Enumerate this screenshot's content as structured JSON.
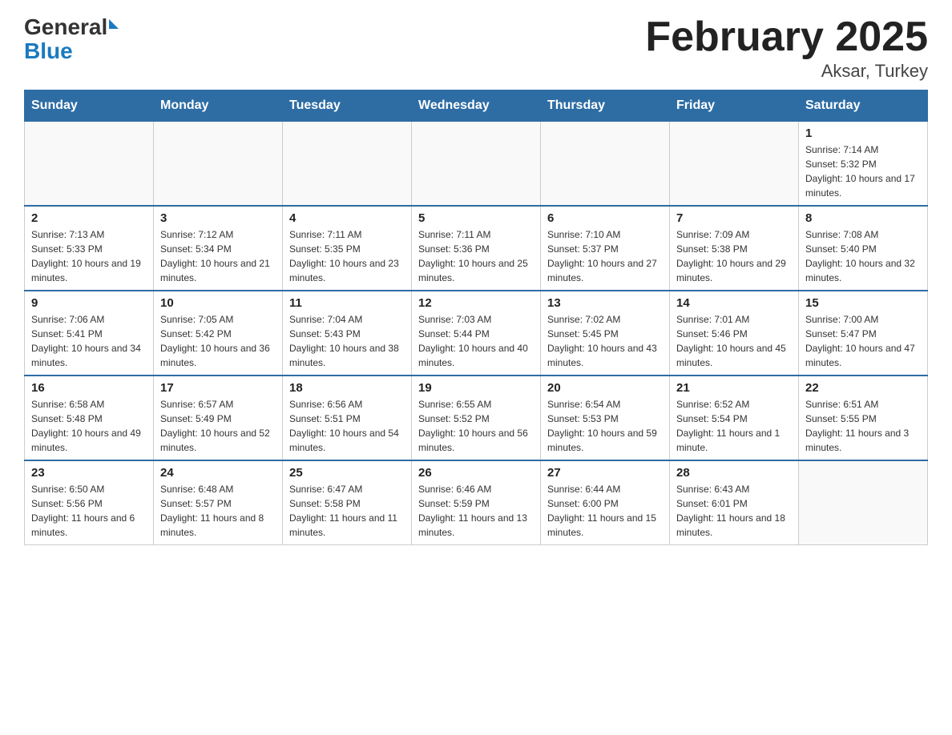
{
  "header": {
    "logo_general": "General",
    "logo_blue": "Blue",
    "month_title": "February 2025",
    "location": "Aksar, Turkey"
  },
  "weekdays": [
    "Sunday",
    "Monday",
    "Tuesday",
    "Wednesday",
    "Thursday",
    "Friday",
    "Saturday"
  ],
  "weeks": [
    [
      {
        "day": "",
        "info": ""
      },
      {
        "day": "",
        "info": ""
      },
      {
        "day": "",
        "info": ""
      },
      {
        "day": "",
        "info": ""
      },
      {
        "day": "",
        "info": ""
      },
      {
        "day": "",
        "info": ""
      },
      {
        "day": "1",
        "info": "Sunrise: 7:14 AM\nSunset: 5:32 PM\nDaylight: 10 hours and 17 minutes."
      }
    ],
    [
      {
        "day": "2",
        "info": "Sunrise: 7:13 AM\nSunset: 5:33 PM\nDaylight: 10 hours and 19 minutes."
      },
      {
        "day": "3",
        "info": "Sunrise: 7:12 AM\nSunset: 5:34 PM\nDaylight: 10 hours and 21 minutes."
      },
      {
        "day": "4",
        "info": "Sunrise: 7:11 AM\nSunset: 5:35 PM\nDaylight: 10 hours and 23 minutes."
      },
      {
        "day": "5",
        "info": "Sunrise: 7:11 AM\nSunset: 5:36 PM\nDaylight: 10 hours and 25 minutes."
      },
      {
        "day": "6",
        "info": "Sunrise: 7:10 AM\nSunset: 5:37 PM\nDaylight: 10 hours and 27 minutes."
      },
      {
        "day": "7",
        "info": "Sunrise: 7:09 AM\nSunset: 5:38 PM\nDaylight: 10 hours and 29 minutes."
      },
      {
        "day": "8",
        "info": "Sunrise: 7:08 AM\nSunset: 5:40 PM\nDaylight: 10 hours and 32 minutes."
      }
    ],
    [
      {
        "day": "9",
        "info": "Sunrise: 7:06 AM\nSunset: 5:41 PM\nDaylight: 10 hours and 34 minutes."
      },
      {
        "day": "10",
        "info": "Sunrise: 7:05 AM\nSunset: 5:42 PM\nDaylight: 10 hours and 36 minutes."
      },
      {
        "day": "11",
        "info": "Sunrise: 7:04 AM\nSunset: 5:43 PM\nDaylight: 10 hours and 38 minutes."
      },
      {
        "day": "12",
        "info": "Sunrise: 7:03 AM\nSunset: 5:44 PM\nDaylight: 10 hours and 40 minutes."
      },
      {
        "day": "13",
        "info": "Sunrise: 7:02 AM\nSunset: 5:45 PM\nDaylight: 10 hours and 43 minutes."
      },
      {
        "day": "14",
        "info": "Sunrise: 7:01 AM\nSunset: 5:46 PM\nDaylight: 10 hours and 45 minutes."
      },
      {
        "day": "15",
        "info": "Sunrise: 7:00 AM\nSunset: 5:47 PM\nDaylight: 10 hours and 47 minutes."
      }
    ],
    [
      {
        "day": "16",
        "info": "Sunrise: 6:58 AM\nSunset: 5:48 PM\nDaylight: 10 hours and 49 minutes."
      },
      {
        "day": "17",
        "info": "Sunrise: 6:57 AM\nSunset: 5:49 PM\nDaylight: 10 hours and 52 minutes."
      },
      {
        "day": "18",
        "info": "Sunrise: 6:56 AM\nSunset: 5:51 PM\nDaylight: 10 hours and 54 minutes."
      },
      {
        "day": "19",
        "info": "Sunrise: 6:55 AM\nSunset: 5:52 PM\nDaylight: 10 hours and 56 minutes."
      },
      {
        "day": "20",
        "info": "Sunrise: 6:54 AM\nSunset: 5:53 PM\nDaylight: 10 hours and 59 minutes."
      },
      {
        "day": "21",
        "info": "Sunrise: 6:52 AM\nSunset: 5:54 PM\nDaylight: 11 hours and 1 minute."
      },
      {
        "day": "22",
        "info": "Sunrise: 6:51 AM\nSunset: 5:55 PM\nDaylight: 11 hours and 3 minutes."
      }
    ],
    [
      {
        "day": "23",
        "info": "Sunrise: 6:50 AM\nSunset: 5:56 PM\nDaylight: 11 hours and 6 minutes."
      },
      {
        "day": "24",
        "info": "Sunrise: 6:48 AM\nSunset: 5:57 PM\nDaylight: 11 hours and 8 minutes."
      },
      {
        "day": "25",
        "info": "Sunrise: 6:47 AM\nSunset: 5:58 PM\nDaylight: 11 hours and 11 minutes."
      },
      {
        "day": "26",
        "info": "Sunrise: 6:46 AM\nSunset: 5:59 PM\nDaylight: 11 hours and 13 minutes."
      },
      {
        "day": "27",
        "info": "Sunrise: 6:44 AM\nSunset: 6:00 PM\nDaylight: 11 hours and 15 minutes."
      },
      {
        "day": "28",
        "info": "Sunrise: 6:43 AM\nSunset: 6:01 PM\nDaylight: 11 hours and 18 minutes."
      },
      {
        "day": "",
        "info": ""
      }
    ]
  ]
}
